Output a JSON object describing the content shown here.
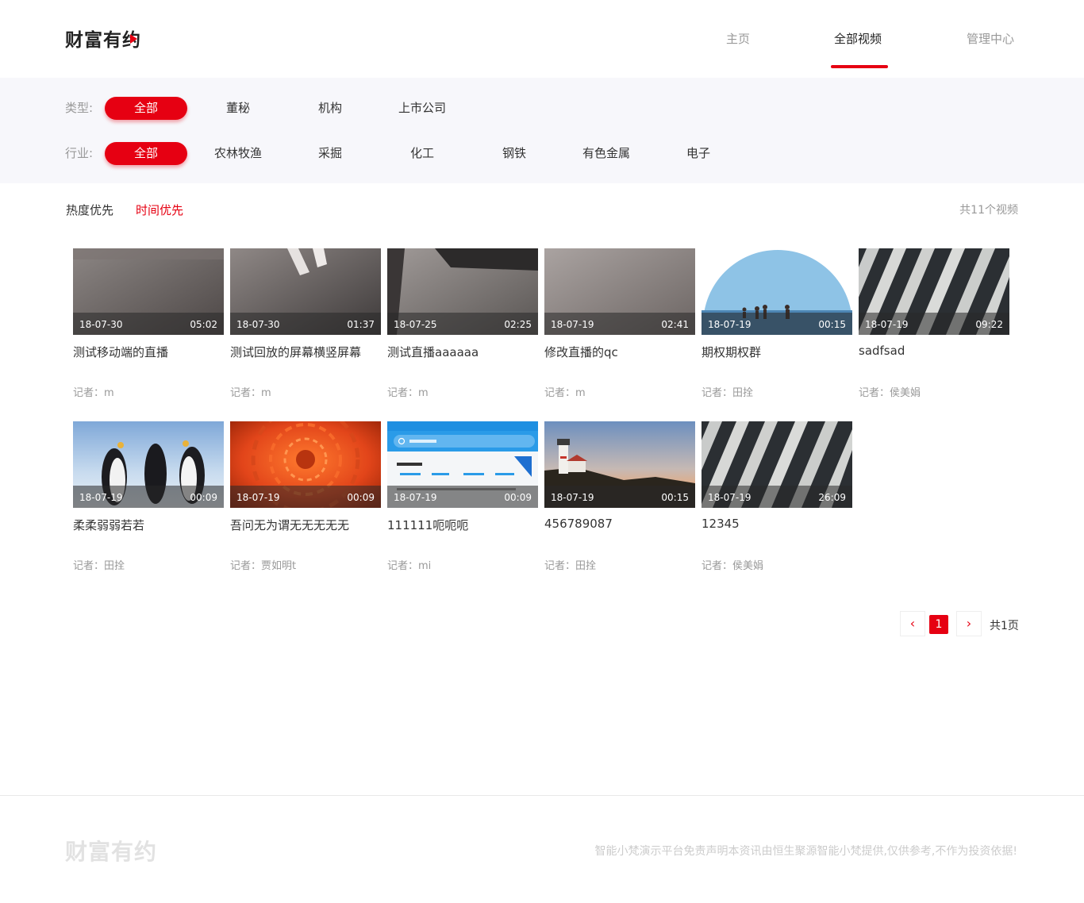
{
  "header": {
    "logo_text": "财富有约",
    "nav": [
      {
        "label": "主页",
        "active": false
      },
      {
        "label": "全部视频",
        "active": true
      },
      {
        "label": "管理中心",
        "active": false
      }
    ]
  },
  "filters": {
    "type_label": "类型:",
    "types": [
      "全部",
      "董秘",
      "机构",
      "上市公司"
    ],
    "industry_label": "行业:",
    "industries": [
      "全部",
      "农林牧渔",
      "采掘",
      "化工",
      "钢铁",
      "有色金属",
      "电子"
    ]
  },
  "sort": {
    "options": [
      "热度优先",
      "时间优先"
    ],
    "active_index": 1,
    "total": "共11个视频"
  },
  "videos": [
    {
      "date": "18-07-30",
      "duration": "05:02",
      "title": "测试移动端的直播",
      "reporter": "记者：m"
    },
    {
      "date": "18-07-30",
      "duration": "01:37",
      "title": "测试回放的屏幕横竖屏幕",
      "reporter": "记者：m"
    },
    {
      "date": "18-07-25",
      "duration": "02:25",
      "title": "测试直播aaaaaa",
      "reporter": "记者：m"
    },
    {
      "date": "18-07-19",
      "duration": "02:41",
      "title": "修改直播的qc",
      "reporter": "记者：m"
    },
    {
      "date": "18-07-19",
      "duration": "00:15",
      "title": "期权期权群",
      "reporter": "记者：田拴"
    },
    {
      "date": "18-07-19",
      "duration": "09:22",
      "title": "sadfsad",
      "reporter": "记者：侯美娟"
    },
    {
      "date": "18-07-19",
      "duration": "00:09",
      "title": "柔柔弱弱若若",
      "reporter": "记者：田拴"
    },
    {
      "date": "18-07-19",
      "duration": "00:09",
      "title": "吾问无为谓无无无无无",
      "reporter": "记者：贾如明t"
    },
    {
      "date": "18-07-19",
      "duration": "00:09",
      "title": "111111呃呃呃",
      "reporter": "记者：mi"
    },
    {
      "date": "18-07-19",
      "duration": "00:15",
      "title": "456789087",
      "reporter": "记者：田拴"
    },
    {
      "date": "18-07-19",
      "duration": "26:09",
      "title": "12345",
      "reporter": "记者：侯美娟"
    }
  ],
  "pagination": {
    "prev": "‹",
    "current": "1",
    "next": "›",
    "total": "共1页"
  },
  "footer": {
    "logo_text": "财富有约",
    "disclaimer": "智能小梵演示平台免责声明本资讯由恒生聚源智能小梵提供,仅供参考,不作为投资依据!"
  },
  "colors": {
    "accent": "#e60012",
    "filter_bg": "#f7f7fb"
  }
}
